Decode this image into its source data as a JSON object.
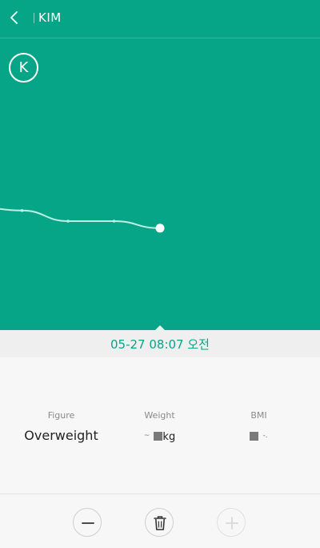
{
  "header": {
    "title": "KIM",
    "back_icon": "chevron-left-icon"
  },
  "profile": {
    "avatar_letter": "K"
  },
  "chart_data": {
    "type": "line",
    "x": [
      0,
      1,
      2,
      3,
      4
    ],
    "values": [
      0.16,
      0.17,
      0.2,
      0.2,
      0.22
    ],
    "highlight_index": 4,
    "title": "",
    "xlabel": "",
    "ylabel": "",
    "grid": false,
    "line_color": "#bfeee2",
    "point_color": "#ffffff",
    "background_color": "#06a587"
  },
  "selected": {
    "datetime": "05-27 08:07 오전"
  },
  "stats": {
    "figure_label": "Figure",
    "figure_value": "Overweight",
    "weight_label": "Weight",
    "weight_prefix": "~",
    "weight_unit": "kg",
    "bmi_label": "BMI",
    "bmi_suffix": "-."
  },
  "actions": {
    "minus_icon": "minus-icon",
    "delete_icon": "trash-icon",
    "plus_icon": "plus-icon"
  },
  "colors": {
    "accent": "#06a587",
    "date_text": "#06a587",
    "disabled": "#d8d8d8"
  }
}
